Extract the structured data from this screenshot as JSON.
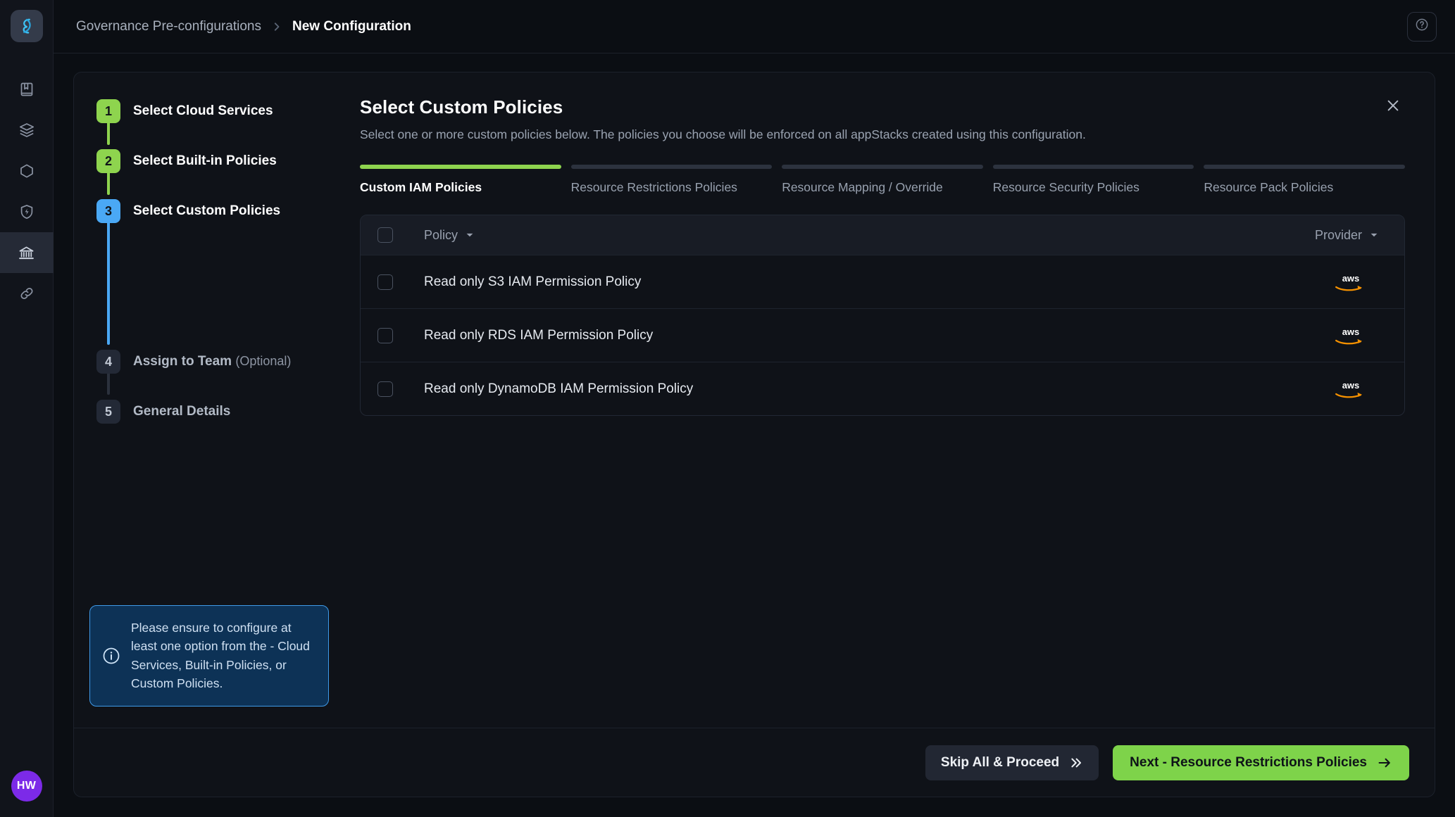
{
  "app": {
    "logo_icon": "stacks-logo-icon",
    "avatar_initials": "HW"
  },
  "rail": {
    "items": [
      {
        "icon": "book-icon",
        "name": "docs"
      },
      {
        "icon": "layers-icon",
        "name": "stacks"
      },
      {
        "icon": "hexagon-icon",
        "name": "resources"
      },
      {
        "icon": "shield-bolt-icon",
        "name": "security"
      },
      {
        "icon": "bank-icon",
        "name": "governance",
        "active": true
      },
      {
        "icon": "link-icon",
        "name": "integrations"
      }
    ]
  },
  "topbar": {
    "breadcrumb_parent": "Governance Pre-configurations",
    "breadcrumb_current": "New Configuration",
    "help_icon": "help-circle-icon"
  },
  "stepper": {
    "steps": [
      {
        "number": "1",
        "label": "Select Cloud Services",
        "state": "done"
      },
      {
        "number": "2",
        "label": "Select Built-in Policies",
        "state": "done"
      },
      {
        "number": "3",
        "label": "Select Custom Policies",
        "state": "active"
      },
      {
        "number": "4",
        "label": "Assign to Team",
        "optional": "(Optional)",
        "state": "todo"
      },
      {
        "number": "5",
        "label": "General Details",
        "state": "todo"
      }
    ]
  },
  "info": {
    "icon": "info-circle-icon",
    "text": "Please ensure to configure at least one option from the - Cloud Services, Built-in Policies, or Custom Policies."
  },
  "main": {
    "title": "Select Custom Policies",
    "subtitle": "Select one or more custom policies below. The policies you choose will be enforced on all appStacks created using this configuration.",
    "close_icon": "close-icon",
    "tabs": [
      {
        "label": "Custom IAM Policies",
        "active": true
      },
      {
        "label": "Resource Restrictions Policies",
        "active": false
      },
      {
        "label": "Resource Mapping / Override",
        "active": false
      },
      {
        "label": "Resource Security Policies",
        "active": false
      },
      {
        "label": "Resource Pack Policies",
        "active": false
      }
    ],
    "table": {
      "columns": {
        "policy": "Policy",
        "provider": "Provider"
      },
      "select_all_checked": false,
      "rows": [
        {
          "name": "Read only S3 IAM Permission Policy",
          "provider": "aws",
          "checked": false
        },
        {
          "name": "Read only RDS IAM Permission Policy",
          "provider": "aws",
          "checked": false
        },
        {
          "name": "Read only DynamoDB IAM Permission Policy",
          "provider": "aws",
          "checked": false
        }
      ]
    }
  },
  "footer": {
    "skip_label": "Skip All & Proceed",
    "next_label": "Next - Resource Restrictions Policies"
  },
  "colors": {
    "green": "#8ed44e",
    "blue": "#4aa8f5",
    "next_button": "#7ed34a",
    "avatar": "#7c2ae8",
    "info_bg": "#0d3256",
    "info_border": "#3f9ae8",
    "aws_orange": "#f59100"
  }
}
